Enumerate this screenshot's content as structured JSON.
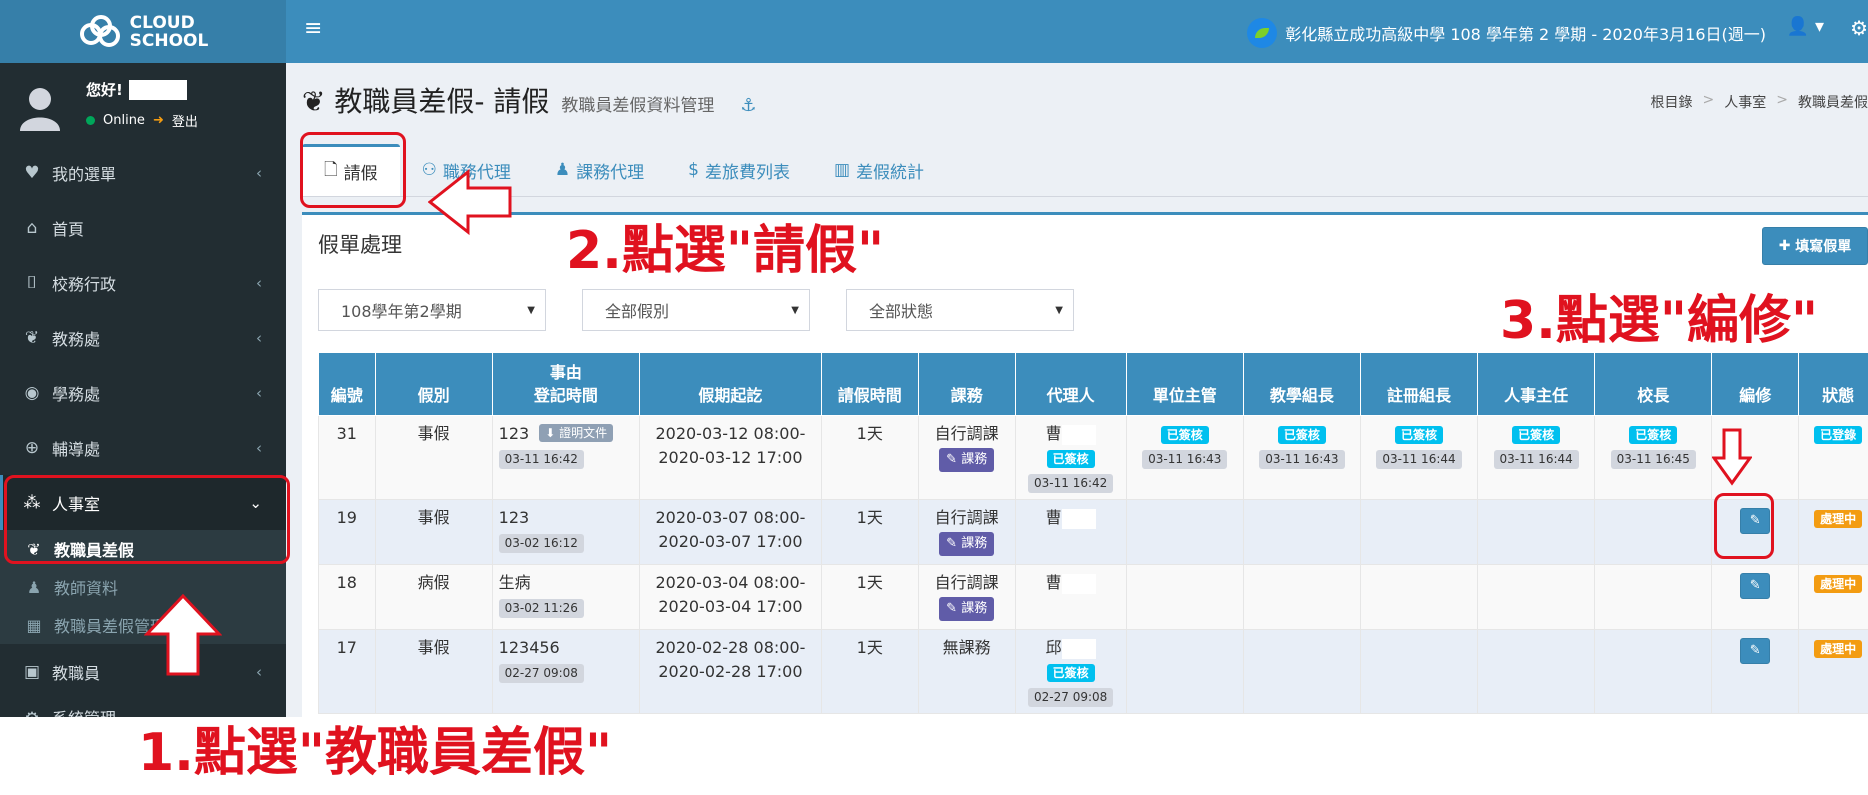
{
  "app": {
    "logo_line1": "CLOUD",
    "logo_line2": "SCHOOL"
  },
  "topbar": {
    "school_info": "彰化縣立成功高級中學 108 學年第 2 學期 - 2020年3月16日(週一)"
  },
  "user": {
    "greeting": "您好!",
    "status": "Online",
    "logout": "登出"
  },
  "sidebar": {
    "items": [
      {
        "label": "我的選單",
        "icon": "heart-icon"
      },
      {
        "label": "首頁",
        "icon": "home-icon"
      },
      {
        "label": "校務行政",
        "icon": "bank-icon"
      },
      {
        "label": "教務處",
        "icon": "leaf-icon"
      },
      {
        "label": "學務處",
        "icon": "accessibility-icon"
      },
      {
        "label": "輔導處",
        "icon": "lifebuoy-icon"
      },
      {
        "label": "人事室",
        "icon": "cubes-icon"
      },
      {
        "label": "教職員",
        "icon": "id-card-icon"
      },
      {
        "label": "系統管理",
        "icon": "gear-icon"
      }
    ],
    "submenu": [
      {
        "label": "教職員差假",
        "icon": "pagelines-icon"
      },
      {
        "label": "教師資料",
        "icon": "person-icon"
      },
      {
        "label": "教職員差假管理",
        "icon": "grid-icon"
      }
    ]
  },
  "page": {
    "title": "教職員差假- 請假",
    "subtitle": "教職員差假資料管理"
  },
  "breadcrumb": [
    "根目錄",
    "人事室",
    "教職員差假"
  ],
  "tabs": [
    {
      "label": "請假",
      "icon": "file-icon"
    },
    {
      "label": "職務代理",
      "icon": "users-icon"
    },
    {
      "label": "課務代理",
      "icon": "person-icon"
    },
    {
      "label": "差旅費列表",
      "icon": "dollar-icon"
    },
    {
      "label": "差假統計",
      "icon": "bar-chart-icon"
    }
  ],
  "box": {
    "title": "假單處理",
    "add_button": "填寫假單"
  },
  "filters": {
    "semester": "108學年第2學期",
    "leave_type": "全部假別",
    "status": "全部狀態"
  },
  "table": {
    "headers": [
      "編號",
      "假別",
      "事由",
      "登記時間",
      "假期起訖",
      "請假時間",
      "課務",
      "代理人",
      "單位主管",
      "教學組長",
      "註冊組長",
      "人事主任",
      "校長",
      "編修",
      "狀態"
    ],
    "rows": [
      {
        "id": "31",
        "type": "事假",
        "reason": "123",
        "doc": "證明文件",
        "reg_time": "03-11 16:42",
        "start": "2020-03-12 08:00-",
        "end": "2020-03-12 17:00",
        "duration": "1天",
        "course": "自行調課",
        "course_btn": "課務",
        "agent": "曹",
        "agent_status": "已簽核",
        "agent_time": "03-11 16:42",
        "approvals": [
          {
            "status": "已簽核",
            "time": "03-11 16:43"
          },
          {
            "status": "已簽核",
            "time": "03-11 16:43"
          },
          {
            "status": "已簽核",
            "time": "03-11 16:44"
          },
          {
            "status": "已簽核",
            "time": "03-11 16:44"
          },
          {
            "status": "已簽核",
            "time": "03-11 16:45"
          }
        ],
        "state": "已登錄"
      },
      {
        "id": "19",
        "type": "事假",
        "reason": "123",
        "reg_time": "03-02 16:12",
        "start": "2020-03-07 08:00-",
        "end": "2020-03-07 17:00",
        "duration": "1天",
        "course": "自行調課",
        "course_btn": "課務",
        "agent": "曹",
        "state": "處理中"
      },
      {
        "id": "18",
        "type": "病假",
        "reason": "生病",
        "reg_time": "03-02 11:26",
        "start": "2020-03-04 08:00-",
        "end": "2020-03-04 17:00",
        "duration": "1天",
        "course": "自行調課",
        "course_btn": "課務",
        "agent": "曹",
        "state": "處理中"
      },
      {
        "id": "17",
        "type": "事假",
        "reason": "123456",
        "reg_time": "02-27 09:08",
        "start": "2020-02-28 08:00-",
        "end": "2020-02-28 17:00",
        "duration": "1天",
        "course": "無課務",
        "agent": "邱",
        "agent_status": "已簽核",
        "agent_time": "02-27 09:08",
        "state": "處理中"
      }
    ]
  },
  "annotations": {
    "step1": "1.點選\"教職員差假\"",
    "step2": "2.點選\"請假\"",
    "step3": "3.點選\"編修\""
  },
  "colors": {
    "accent": "#3c8dbc",
    "sidebar": "#222d32",
    "annotation": "#e0121f",
    "processing": "#f39c12",
    "approved": "#00c0ef"
  }
}
